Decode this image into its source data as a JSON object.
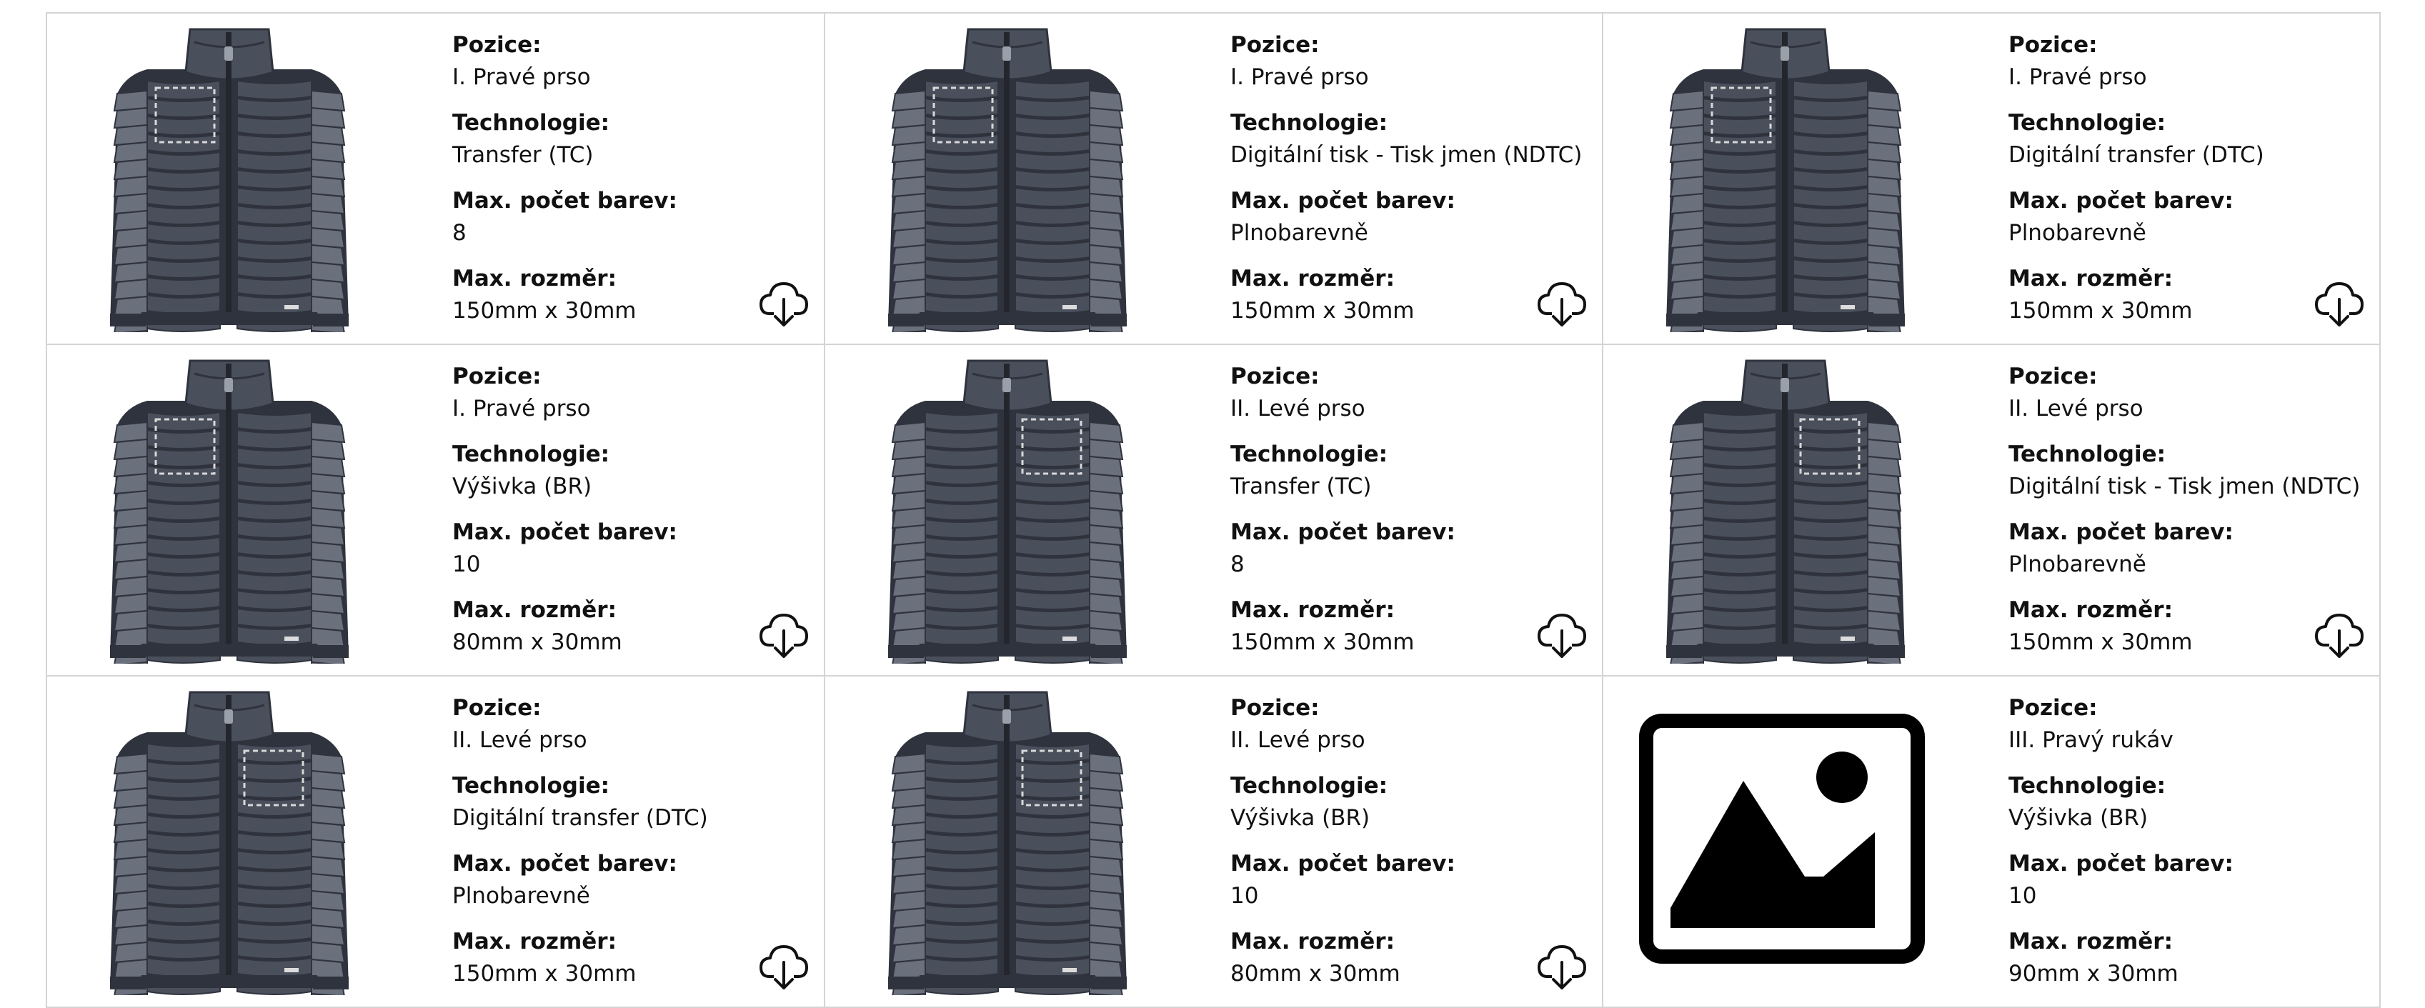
{
  "labels": {
    "position": "Pozice:",
    "technology": "Technologie:",
    "colors": "Max. počet barev:",
    "size": "Max. rozměr:"
  },
  "items": [
    {
      "image": "jacket",
      "print_area": "right-chest",
      "position": "I. Pravé prso",
      "technology": "Transfer (TC)",
      "colors": "8",
      "size": "150mm x 30mm",
      "download": true
    },
    {
      "image": "jacket",
      "print_area": "right-chest",
      "position": "I. Pravé prso",
      "technology": "Digitální tisk - Tisk jmen (NDTC)",
      "colors": "Plnobarevně",
      "size": "150mm x 30mm",
      "download": true
    },
    {
      "image": "jacket",
      "print_area": "right-chest",
      "position": "I. Pravé prso",
      "technology": "Digitální transfer (DTC)",
      "colors": "Plnobarevně",
      "size": "150mm x 30mm",
      "download": true
    },
    {
      "image": "jacket",
      "print_area": "right-chest",
      "position": "I. Pravé prso",
      "technology": "Výšivka (BR)",
      "colors": "10",
      "size": "80mm x 30mm",
      "download": true
    },
    {
      "image": "jacket",
      "print_area": "left-chest",
      "position": "II. Levé prso",
      "technology": "Transfer (TC)",
      "colors": "8",
      "size": "150mm x 30mm",
      "download": true
    },
    {
      "image": "jacket",
      "print_area": "left-chest",
      "position": "II. Levé prso",
      "technology": "Digitální tisk - Tisk jmen (NDTC)",
      "colors": "Plnobarevně",
      "size": "150mm x 30mm",
      "download": true
    },
    {
      "image": "jacket",
      "print_area": "left-chest",
      "position": "II. Levé prso",
      "technology": "Digitální transfer (DTC)",
      "colors": "Plnobarevně",
      "size": "150mm x 30mm",
      "download": true
    },
    {
      "image": "jacket",
      "print_area": "left-chest",
      "position": "II. Levé prso",
      "technology": "Výšivka (BR)",
      "colors": "10",
      "size": "80mm x 30mm",
      "download": true
    },
    {
      "image": "image-placeholder-icon",
      "print_area": "none",
      "position": "III. Pravý rukáv",
      "technology": "Výšivka (BR)",
      "colors": "10",
      "size": "90mm x 30mm",
      "download": false
    }
  ],
  "colors": {
    "jacket": "#4a4f5c",
    "jacket_dark": "#2f333d",
    "jacket_light": "#6b707d",
    "border": "#d4d4d4"
  }
}
